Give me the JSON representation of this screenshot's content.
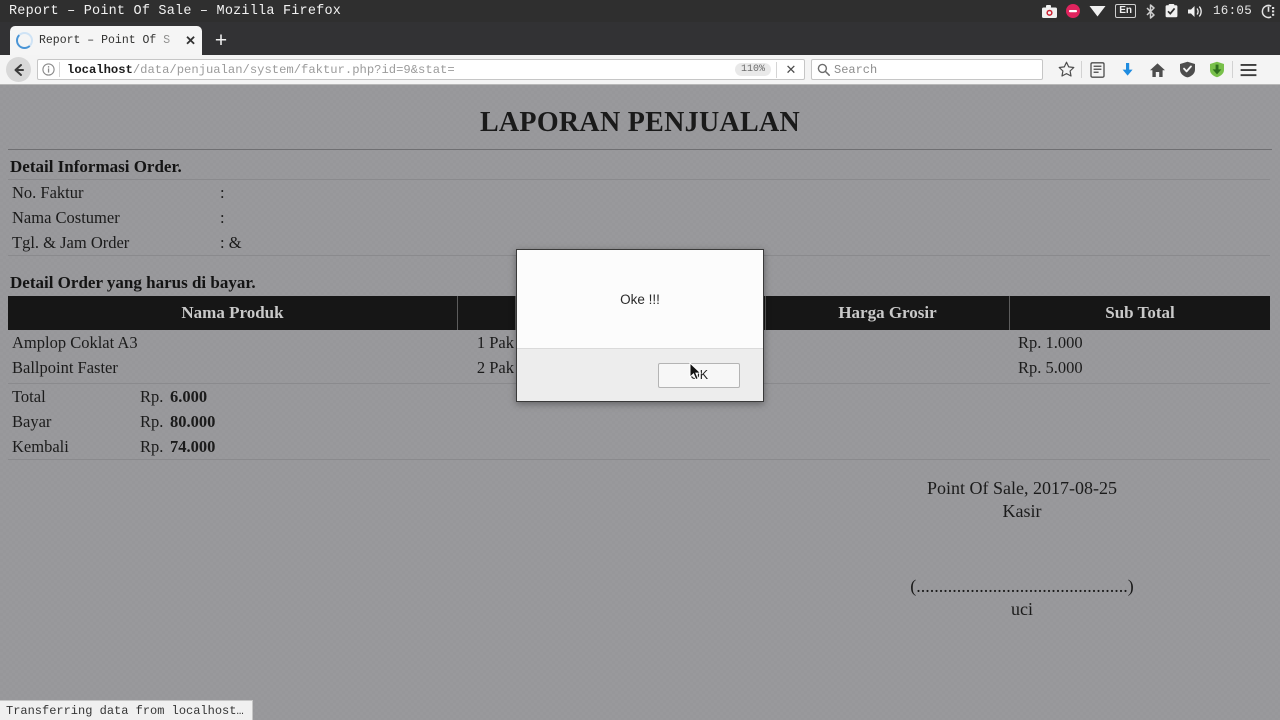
{
  "window": {
    "title": "Report – Point Of Sale – Mozilla Firefox"
  },
  "tray": {
    "icons": [
      "camera-icon",
      "do-not-disturb-icon",
      "wifi-icon",
      "keyboard-layout-icon",
      "bluetooth-icon",
      "checkbox-icon",
      "volume-icon",
      "power-icon"
    ],
    "language": "En",
    "clock": "16:05"
  },
  "browser": {
    "tab": {
      "title": "Report – Point Of S",
      "close_label": "✕"
    },
    "newtab_label": "+",
    "url_prefix": "localhost",
    "url_rest": "/data/penjualan/system/faktur.php?id=9&stat=",
    "zoom_level": "110%",
    "stop_label": "✕",
    "search_placeholder": "Search",
    "toolbar_icons": [
      "bookmark-star-icon",
      "library-icon",
      "downloads-icon",
      "home-icon",
      "shield-icon",
      "addon-download-icon",
      "hamburger-menu-icon"
    ]
  },
  "report": {
    "title": "LAPORAN PENJUALAN",
    "section_info_heading": "Detail Informasi Order.",
    "info_rows": [
      {
        "label": "No. Faktur",
        "value": ":"
      },
      {
        "label": "Nama Costumer",
        "value": ":"
      },
      {
        "label": "Tgl. & Jam Order",
        "value": ": &"
      }
    ],
    "section_order_heading": "Detail Order yang harus di bayar.",
    "table_headers": [
      "Nama Produk",
      "",
      "",
      "Harga Grosir",
      "Sub Total"
    ],
    "table_rows": [
      {
        "produk": "Amplop Coklat A3",
        "qty": "1 Pak",
        "satuan": "",
        "harga_grosir": "",
        "sub_total": "Rp. 1.000"
      },
      {
        "produk": "Ballpoint Faster",
        "qty": "2 Pak",
        "satuan": "",
        "harga_grosir": "",
        "sub_total": "Rp. 5.000"
      }
    ],
    "totals": [
      {
        "label": "Total",
        "currency": "Rp.",
        "amount": "6.000"
      },
      {
        "label": "Bayar",
        "currency": "Rp.",
        "amount": "80.000"
      },
      {
        "label": "Kembali",
        "currency": "Rp.",
        "amount": "74.000"
      }
    ],
    "footer_place_date": "Point Of Sale, 2017-08-25",
    "footer_role": "Kasir",
    "footer_signature_line": "(...............................................)",
    "footer_signer": "uci"
  },
  "modal": {
    "message": "Oke !!!",
    "ok_label": "OK"
  },
  "statusbar": {
    "text": "Transferring data from localhost…"
  }
}
